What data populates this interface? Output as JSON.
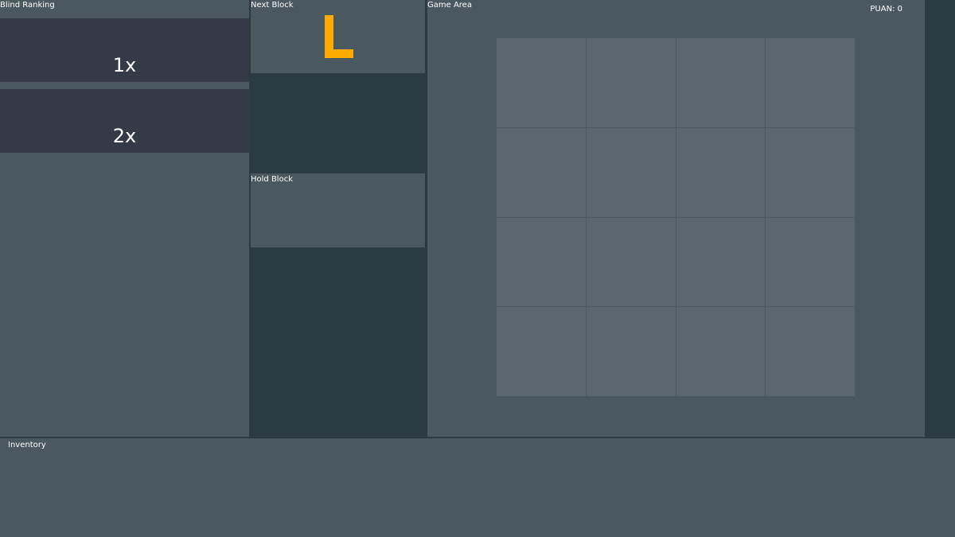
{
  "blind_ranking": {
    "title": "Blind Ranking",
    "items": [
      {
        "label": "1x"
      },
      {
        "label": "2x"
      }
    ]
  },
  "next_block": {
    "title": "Next Block",
    "piece": "L",
    "color": "#ffaa00"
  },
  "hold_block": {
    "title": "Hold Block"
  },
  "game_area": {
    "title": "Game Area",
    "score_text": "PUAN: 0",
    "grid_rows": 4,
    "grid_cols": 4
  },
  "inventory": {
    "title": "Inventory"
  },
  "colors": {
    "background": "#2a3b43",
    "panel": "#4a585f",
    "rank_item": "#343a47",
    "cell": "#5b676e",
    "accent": "#ffaa00"
  }
}
